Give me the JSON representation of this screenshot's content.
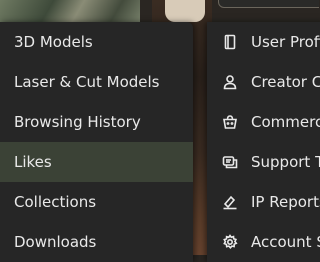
{
  "left_menu": {
    "items": [
      {
        "label": "3D Models"
      },
      {
        "label": "Laser & Cut Models"
      },
      {
        "label": "Browsing History"
      },
      {
        "label": "Likes"
      },
      {
        "label": "Collections"
      },
      {
        "label": "Downloads"
      }
    ],
    "active_index": 3
  },
  "right_menu": {
    "items": [
      {
        "label": "User Profi",
        "icon": "profile-card-icon"
      },
      {
        "label": "Creator C",
        "icon": "person-icon"
      },
      {
        "label": "Commerc",
        "icon": "commerce-icon"
      },
      {
        "label": "Support T",
        "icon": "support-ticket-icon"
      },
      {
        "label": "IP Reports",
        "icon": "ip-report-icon"
      },
      {
        "label": "Account S",
        "icon": "gear-icon"
      }
    ]
  },
  "colors": {
    "menu_bg": "#262626",
    "active_bg": "#3b4236",
    "text": "#e9e9e9"
  }
}
